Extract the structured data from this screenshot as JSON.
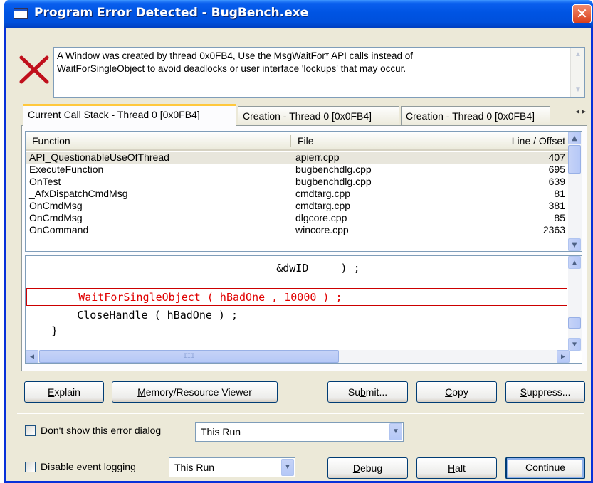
{
  "window": {
    "title": "Program Error Detected - BugBench.exe",
    "close_glyph": "✕"
  },
  "message": {
    "line1": "A Window was created by thread 0x0FB4, Use the MsgWaitFor* API calls instead of",
    "line2": "WaitForSingleObject to avoid deadlocks or user interface 'lockups' that may occur."
  },
  "tabs": [
    {
      "label": "Current Call Stack - Thread 0 [0x0FB4]"
    },
    {
      "label": "Creation - Thread 0 [0x0FB4]"
    },
    {
      "label": "Creation - Thread 0 [0x0FB4]"
    }
  ],
  "tab_arrows": "◂ ▸",
  "callstack": {
    "headers": {
      "function": "Function",
      "file": "File",
      "line": "Line / Offset"
    },
    "rows": [
      {
        "function": "API_QuestionableUseOfThread",
        "file": "apierr.cpp",
        "line": "407"
      },
      {
        "function": "ExecuteFunction",
        "file": "bugbenchdlg.cpp",
        "line": "695"
      },
      {
        "function": "OnTest",
        "file": "bugbenchdlg.cpp",
        "line": "639"
      },
      {
        "function": "_AfxDispatchCmdMsg",
        "file": "cmdtarg.cpp",
        "line": "81"
      },
      {
        "function": "OnCmdMsg",
        "file": "cmdtarg.cpp",
        "line": "381"
      },
      {
        "function": "OnCmdMsg",
        "file": "dlgcore.cpp",
        "line": "85"
      },
      {
        "function": "OnCommand",
        "file": "wincore.cpp",
        "line": "2363"
      }
    ]
  },
  "source": {
    "lines": [
      "                                       &dwID     ) ;",
      "",
      "        WaitForSingleObject ( hBadOne , 10000 ) ;",
      "        CloseHandle ( hBadOne ) ;",
      "    }"
    ],
    "hscroll_grip": "III"
  },
  "buttons": {
    "explain": {
      "pre": "",
      "key": "E",
      "post": "xplain"
    },
    "memory": {
      "pre": "",
      "key": "M",
      "post": "emory/Resource Viewer"
    },
    "submit": {
      "pre": "Su",
      "key": "b",
      "post": "mit..."
    },
    "copy": {
      "pre": "",
      "key": "C",
      "post": "opy"
    },
    "suppress": {
      "pre": "",
      "key": "S",
      "post": "uppress..."
    },
    "debug": {
      "pre": "",
      "key": "D",
      "post": "ebug"
    },
    "halt": {
      "pre": "",
      "key": "H",
      "post": "alt"
    },
    "continue": {
      "label": "Continue"
    }
  },
  "options": {
    "dont_show": {
      "pre": "Don't show ",
      "key": "t",
      "post": "his error dialog",
      "value": "This Run"
    },
    "disable_logging": {
      "label": "Disable event logging",
      "value": "This Run"
    }
  },
  "colors": {
    "title_blue": "#0054e3",
    "error_red": "#c0101c",
    "highlight_text": "#e00000"
  },
  "icons": {
    "error": "x-error-icon"
  }
}
